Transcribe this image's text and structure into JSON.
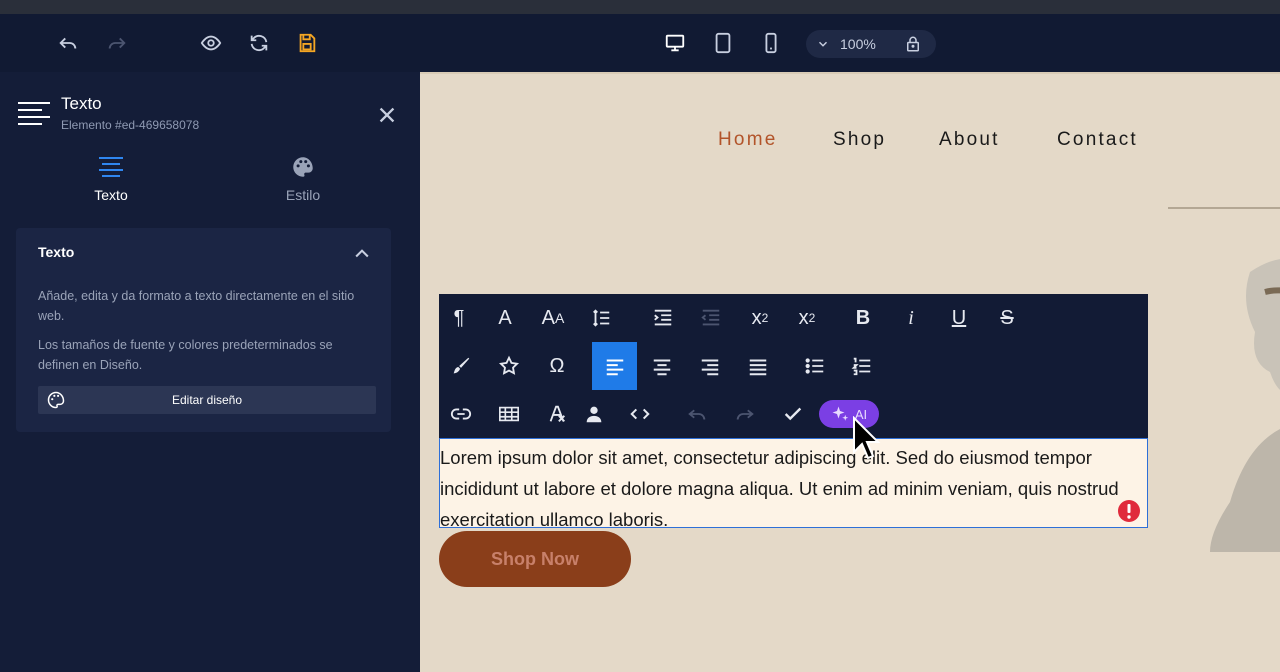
{
  "topbar": {
    "zoom": "100%",
    "icons": [
      "undo-icon",
      "redo-icon",
      "preview-eye-icon",
      "refresh-icon",
      "save-icon",
      "desktop-icon",
      "tablet-icon",
      "mobile-icon",
      "chevron-down-icon",
      "lock-icon"
    ],
    "save_color": "#f5a623"
  },
  "panel": {
    "title": "Texto",
    "subtitle": "Elemento #ed-469658078",
    "tabs": [
      {
        "label": "Texto",
        "icon": "text-lines-icon",
        "active": true
      },
      {
        "label": "Estilo",
        "icon": "palette-icon",
        "active": false
      }
    ],
    "card": {
      "title": "Texto",
      "p1": "Añade, edita y da formato a texto directamente en el sitio web.",
      "p2": "Los tamaños de fuente y colores predeterminados se definen en Diseño.",
      "button": "Editar diseño"
    }
  },
  "canvas": {
    "nav": [
      "Home",
      "Shop",
      "About",
      "Contact"
    ],
    "cta": "Shop Now",
    "body_text": "Lorem ipsum dolor sit amet, consectetur adipiscing elit. Sed do eiusmod tempor incididunt ut labore et dolore magna aliqua. Ut enim ad minim veniam, quis nostrud exercitation ullamco laboris.",
    "accent": "#b2542a"
  },
  "toolbar": {
    "ai_label": "AI",
    "active_color": "#1f7be8",
    "ai_color": "#7b3fe4"
  }
}
